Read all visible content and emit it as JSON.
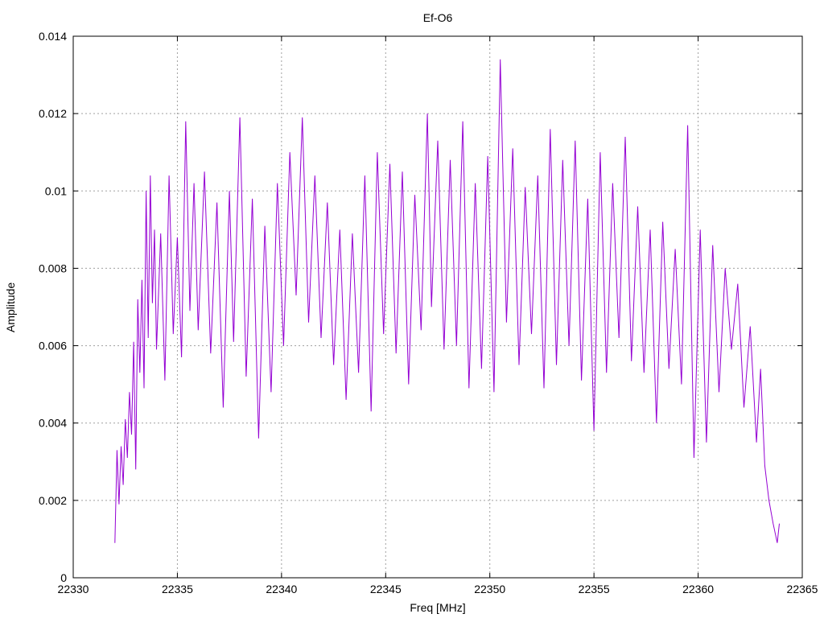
{
  "chart_data": {
    "type": "line",
    "title": "Ef-O6",
    "xlabel": "Freq [MHz]",
    "ylabel": "Amplitude",
    "xlim": [
      22330,
      22365
    ],
    "ylim": [
      0,
      0.014
    ],
    "xticks": [
      22330,
      22335,
      22340,
      22345,
      22350,
      22355,
      22360,
      22365
    ],
    "xtick_labels": [
      "22330",
      "22335",
      "22340",
      "22345",
      "22350",
      "22355",
      "22360",
      "22365"
    ],
    "yticks": [
      0,
      0.002,
      0.004,
      0.006,
      0.008,
      0.01,
      0.012,
      0.014
    ],
    "ytick_labels": [
      "0",
      "0.002",
      "0.004",
      "0.006",
      "0.008",
      "0.01",
      "0.012",
      "0.014"
    ],
    "grid": true,
    "series_color": "#9400d3",
    "series": [
      {
        "x": [
          22332.0,
          22332.1,
          22332.2,
          22332.3,
          22332.4,
          22332.5,
          22332.6,
          22332.7,
          22332.8,
          22332.9,
          22333.0,
          22333.1,
          22333.2,
          22333.3,
          22333.4,
          22333.5,
          22333.6,
          22333.7,
          22333.8,
          22333.9,
          22334.0,
          22334.2,
          22334.4,
          22334.6,
          22334.8,
          22335.0,
          22335.2,
          22335.4,
          22335.6,
          22335.8,
          22336.0,
          22336.3,
          22336.6,
          22336.9,
          22337.2,
          22337.5,
          22337.7,
          22338.0,
          22338.3,
          22338.6,
          22338.9,
          22339.2,
          22339.5,
          22339.8,
          22340.1,
          22340.4,
          22340.7,
          22341.0,
          22341.3,
          22341.6,
          22341.9,
          22342.2,
          22342.5,
          22342.8,
          22343.1,
          22343.4,
          22343.7,
          22344.0,
          22344.3,
          22344.6,
          22344.9,
          22345.2,
          22345.5,
          22345.8,
          22346.1,
          22346.4,
          22346.7,
          22347.0,
          22347.2,
          22347.5,
          22347.8,
          22348.1,
          22348.4,
          22348.7,
          22349.0,
          22349.3,
          22349.6,
          22349.9,
          22350.2,
          22350.5,
          22350.8,
          22351.1,
          22351.4,
          22351.7,
          22352.0,
          22352.3,
          22352.6,
          22352.9,
          22353.2,
          22353.5,
          22353.8,
          22354.1,
          22354.4,
          22354.7,
          22355.0,
          22355.3,
          22355.6,
          22355.9,
          22356.2,
          22356.5,
          22356.8,
          22357.1,
          22357.4,
          22357.7,
          22358.0,
          22358.3,
          22358.6,
          22358.9,
          22359.2,
          22359.5,
          22359.8,
          22360.1,
          22360.4,
          22360.7,
          22361.0,
          22361.3,
          22361.6,
          22361.9,
          22362.2,
          22362.5,
          22362.8,
          22363.0,
          22363.2,
          22363.4,
          22363.6,
          22363.8,
          22363.9
        ],
        "y": [
          0.0009,
          0.0033,
          0.0019,
          0.0034,
          0.0024,
          0.0041,
          0.0031,
          0.0048,
          0.0037,
          0.0061,
          0.0028,
          0.0072,
          0.0053,
          0.0077,
          0.0049,
          0.01,
          0.0062,
          0.0104,
          0.0071,
          0.009,
          0.0059,
          0.0089,
          0.0051,
          0.0104,
          0.0063,
          0.0088,
          0.0057,
          0.0118,
          0.0069,
          0.0102,
          0.0064,
          0.0105,
          0.0058,
          0.0097,
          0.0044,
          0.01,
          0.0061,
          0.0119,
          0.0052,
          0.0098,
          0.0036,
          0.0091,
          0.0048,
          0.0102,
          0.006,
          0.011,
          0.0073,
          0.0119,
          0.0066,
          0.0104,
          0.0062,
          0.0097,
          0.0055,
          0.009,
          0.0046,
          0.0089,
          0.0053,
          0.0104,
          0.0043,
          0.011,
          0.0063,
          0.0107,
          0.0058,
          0.0105,
          0.005,
          0.0099,
          0.0064,
          0.012,
          0.007,
          0.0113,
          0.0059,
          0.0108,
          0.006,
          0.0118,
          0.0049,
          0.0102,
          0.0054,
          0.0109,
          0.0048,
          0.0134,
          0.0066,
          0.0111,
          0.0055,
          0.0101,
          0.0063,
          0.0104,
          0.0049,
          0.0116,
          0.0055,
          0.0108,
          0.006,
          0.0113,
          0.0051,
          0.0098,
          0.0038,
          0.011,
          0.0053,
          0.0102,
          0.0062,
          0.0114,
          0.0056,
          0.0096,
          0.0053,
          0.009,
          0.004,
          0.0092,
          0.0054,
          0.0085,
          0.005,
          0.0117,
          0.0031,
          0.009,
          0.0035,
          0.0086,
          0.0048,
          0.008,
          0.0059,
          0.0076,
          0.0044,
          0.0065,
          0.0035,
          0.0054,
          0.0029,
          0.002,
          0.0014,
          0.0009,
          0.0014
        ]
      }
    ]
  }
}
